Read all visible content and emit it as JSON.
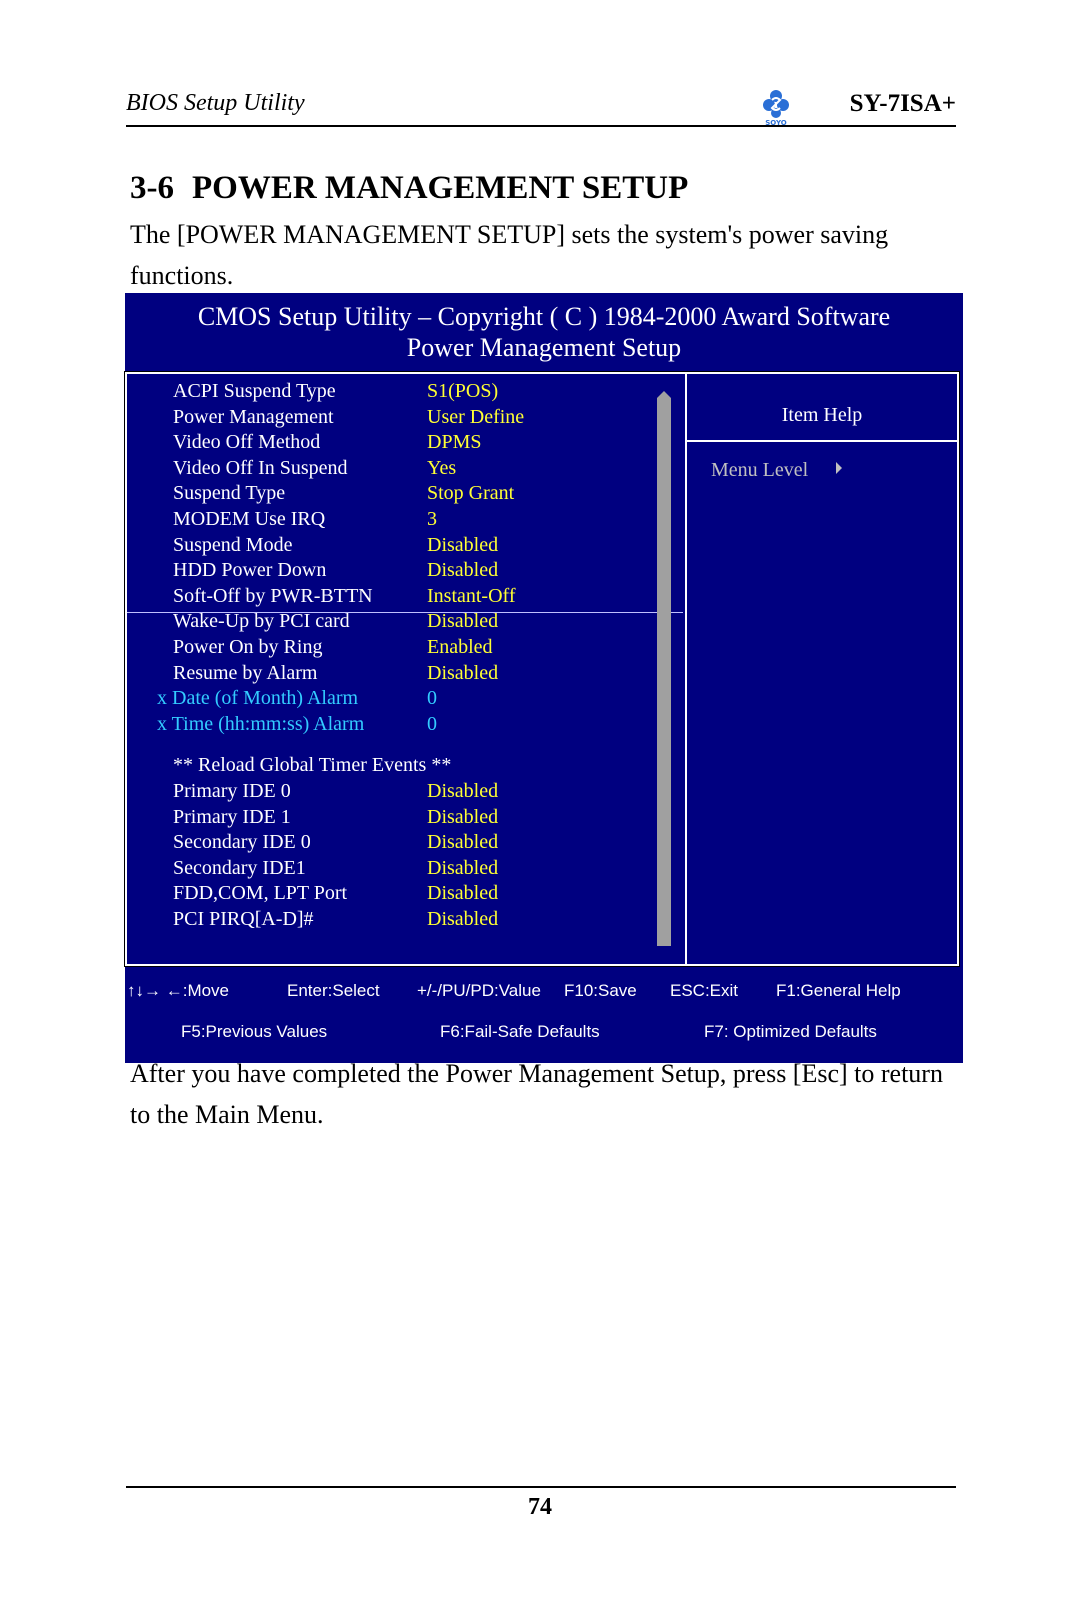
{
  "header": {
    "title": "BIOS Setup Utility",
    "brand": "SOYO",
    "model": "SY-7ISA+"
  },
  "section": {
    "number": "3-6",
    "title": "POWER MANAGEMENT SETUP",
    "intro": "The [POWER MANAGEMENT SETUP] sets the system's power saving functions."
  },
  "bios": {
    "title_line1": "CMOS Setup Utility – Copyright ( C ) 1984-2000 Award Software",
    "title_line2": "Power Management Setup",
    "colors": {
      "background": "#000080",
      "label": "#ffffff",
      "value": "#ffff33",
      "disabled": "#33ccff"
    },
    "settings": [
      {
        "label": "ACPI Suspend Type",
        "value": "S1(POS)"
      },
      {
        "label": "Power Management",
        "value": "User Define"
      },
      {
        "label": "Video Off Method",
        "value": "DPMS"
      },
      {
        "label": "Video Off In Suspend",
        "value": "Yes"
      },
      {
        "label": "Suspend Type",
        "value": "Stop Grant"
      },
      {
        "label": "MODEM Use IRQ",
        "value": "3"
      },
      {
        "label": "Suspend Mode",
        "value": "Disabled"
      },
      {
        "label": "HDD Power Down",
        "value": "Disabled"
      },
      {
        "label": "Soft-Off by PWR-BTTN",
        "value": "Instant-Off"
      },
      {
        "label": "Wake-Up by PCI card",
        "value": "Disabled"
      },
      {
        "label": "Power On by Ring",
        "value": "Enabled"
      },
      {
        "label": "Resume by Alarm",
        "value": "Disabled"
      },
      {
        "label": "x Date (of Month) Alarm",
        "value": "0",
        "disabled": true
      },
      {
        "label": "x Time (hh:mm:ss) Alarm",
        "value": "0",
        "disabled": true
      },
      {
        "label": "** Reload Global Timer Events **",
        "value": "",
        "heading": true
      },
      {
        "label": "Primary IDE 0",
        "value": "Disabled"
      },
      {
        "label": "Primary IDE 1",
        "value": "Disabled"
      },
      {
        "label": "Secondary IDE 0",
        "value": "Disabled"
      },
      {
        "label": "Secondary IDE1",
        "value": "Disabled"
      },
      {
        "label": "FDD,COM, LPT Port",
        "value": "Disabled"
      },
      {
        "label": "PCI PIRQ[A-D]#",
        "value": "Disabled"
      }
    ],
    "help": {
      "title": "Item Help",
      "menu_level": "Menu Level"
    },
    "keys_row1": [
      {
        "label": "↑↓→ ←:Move"
      },
      {
        "label": "Enter:Select"
      },
      {
        "label": "+/-/PU/PD:Value"
      },
      {
        "label": "F10:Save"
      },
      {
        "label": "ESC:Exit"
      },
      {
        "label": "F1:General Help"
      }
    ],
    "keys_row2": [
      {
        "label": "F5:Previous Values"
      },
      {
        "label": "F6:Fail-Safe Defaults"
      },
      {
        "label": "F7: Optimized Defaults"
      }
    ]
  },
  "after_text": "After you have completed the Power Management Setup, press [Esc] to return to the Main Menu.",
  "page_number": "74"
}
